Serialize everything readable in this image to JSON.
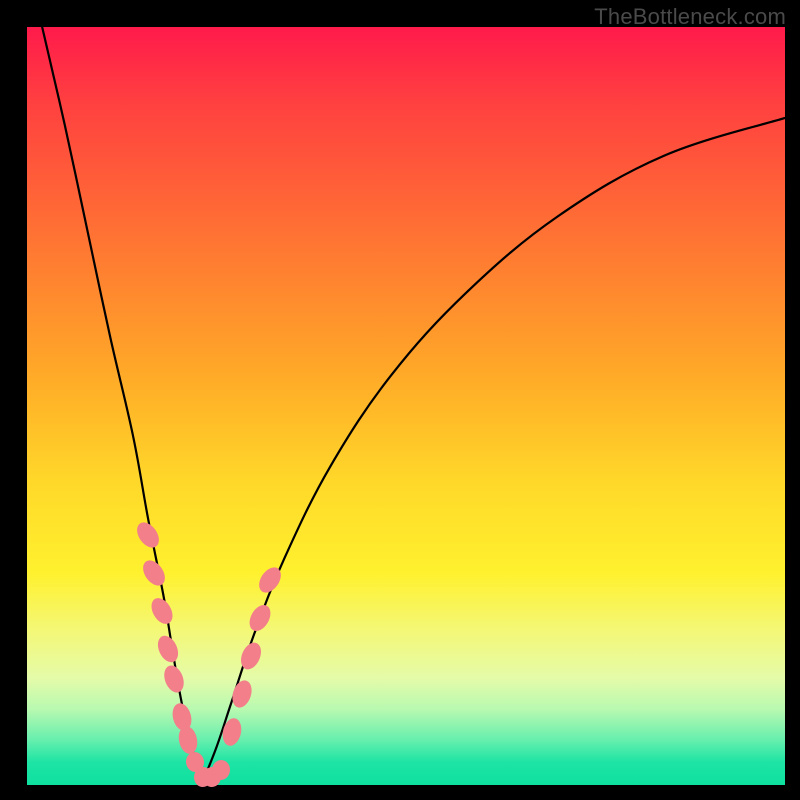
{
  "watermark": "TheBottleneck.com",
  "colors": {
    "gradient_top": "#ff1a4b",
    "gradient_bottom": "#0ee0a0",
    "curve": "#000000",
    "dot": "#f27f8a",
    "frame": "#000000"
  },
  "chart_data": {
    "type": "line",
    "title": "",
    "xlabel": "",
    "ylabel": "",
    "xlim": [
      0,
      100
    ],
    "ylim": [
      0,
      100
    ],
    "grid": false,
    "legend": false,
    "notes": "Bottleneck-style V-shaped curve over vertical rainbow gradient. y represents mismatch magnitude (higher = worse, red; lower = better, green). Minimum near x≈23.",
    "series": [
      {
        "name": "left-branch",
        "x": [
          2,
          5,
          8,
          11,
          14,
          16,
          18,
          19,
          20,
          21,
          22,
          23
        ],
        "y": [
          100,
          87,
          73,
          59,
          46,
          35,
          25,
          19,
          13,
          8,
          4,
          0
        ]
      },
      {
        "name": "right-branch",
        "x": [
          23,
          25,
          27,
          30,
          34,
          40,
          48,
          58,
          70,
          84,
          100
        ],
        "y": [
          0,
          5,
          11,
          20,
          30,
          42,
          54,
          65,
          75,
          83,
          88
        ]
      }
    ],
    "markers": {
      "name": "sample-dots",
      "comment": "Pink lozenge markers clustered along both branches near the trough; values approximate.",
      "points": [
        {
          "x": 16.0,
          "y": 33
        },
        {
          "x": 16.8,
          "y": 28
        },
        {
          "x": 17.8,
          "y": 23
        },
        {
          "x": 18.6,
          "y": 18
        },
        {
          "x": 19.4,
          "y": 14
        },
        {
          "x": 20.4,
          "y": 9
        },
        {
          "x": 21.2,
          "y": 6
        },
        {
          "x": 22.2,
          "y": 3
        },
        {
          "x": 23.2,
          "y": 1
        },
        {
          "x": 24.4,
          "y": 1
        },
        {
          "x": 25.6,
          "y": 2
        },
        {
          "x": 27.0,
          "y": 7
        },
        {
          "x": 28.4,
          "y": 12
        },
        {
          "x": 29.6,
          "y": 17
        },
        {
          "x": 30.8,
          "y": 22
        },
        {
          "x": 32.0,
          "y": 27
        }
      ]
    }
  }
}
